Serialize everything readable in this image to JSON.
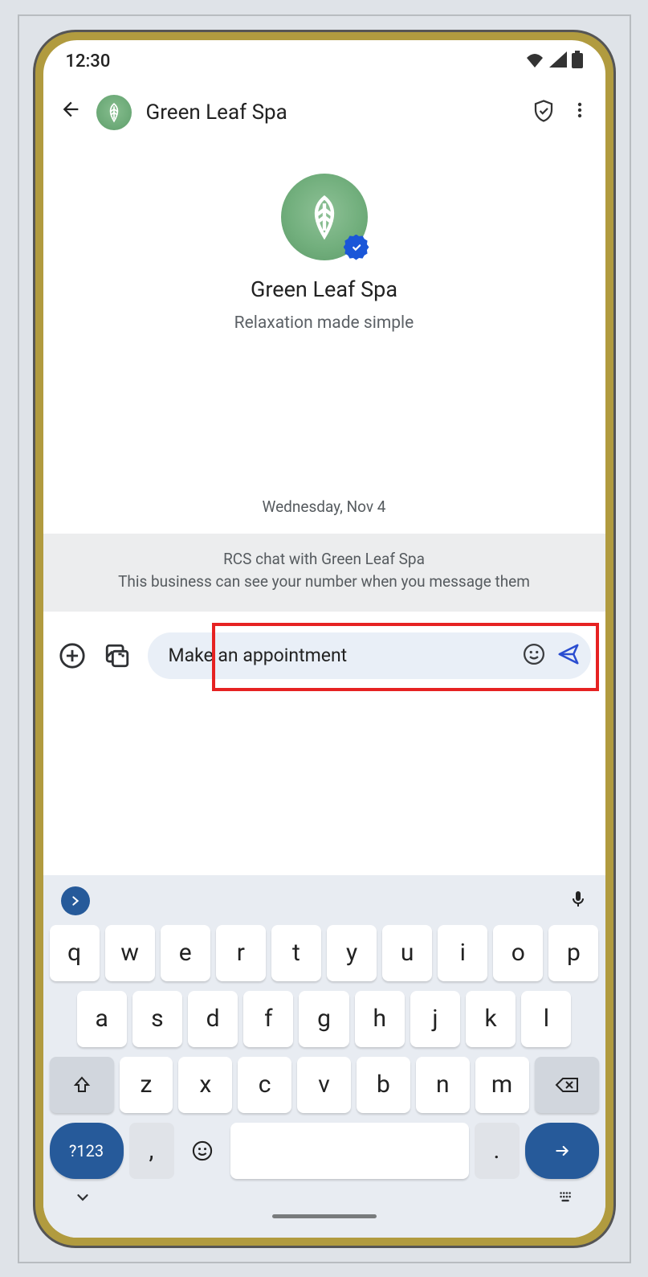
{
  "status": {
    "time": "12:30"
  },
  "header": {
    "title": "Green Leaf Spa"
  },
  "intro": {
    "name": "Green Leaf Spa",
    "tagline": "Relaxation made simple"
  },
  "date_label": "Wednesday, Nov 4",
  "banner": {
    "line1": "RCS chat with Green Leaf Spa",
    "line2": "This business can see your number when you message them"
  },
  "composer": {
    "input_value": "Make an appointment"
  },
  "keyboard": {
    "row1": [
      "q",
      "w",
      "e",
      "r",
      "t",
      "y",
      "u",
      "i",
      "o",
      "p"
    ],
    "row2": [
      "a",
      "s",
      "d",
      "f",
      "g",
      "h",
      "j",
      "k",
      "l"
    ],
    "row3": [
      "z",
      "x",
      "c",
      "v",
      "b",
      "n",
      "m"
    ],
    "sym_label": "?123",
    "comma": ",",
    "period": "."
  }
}
